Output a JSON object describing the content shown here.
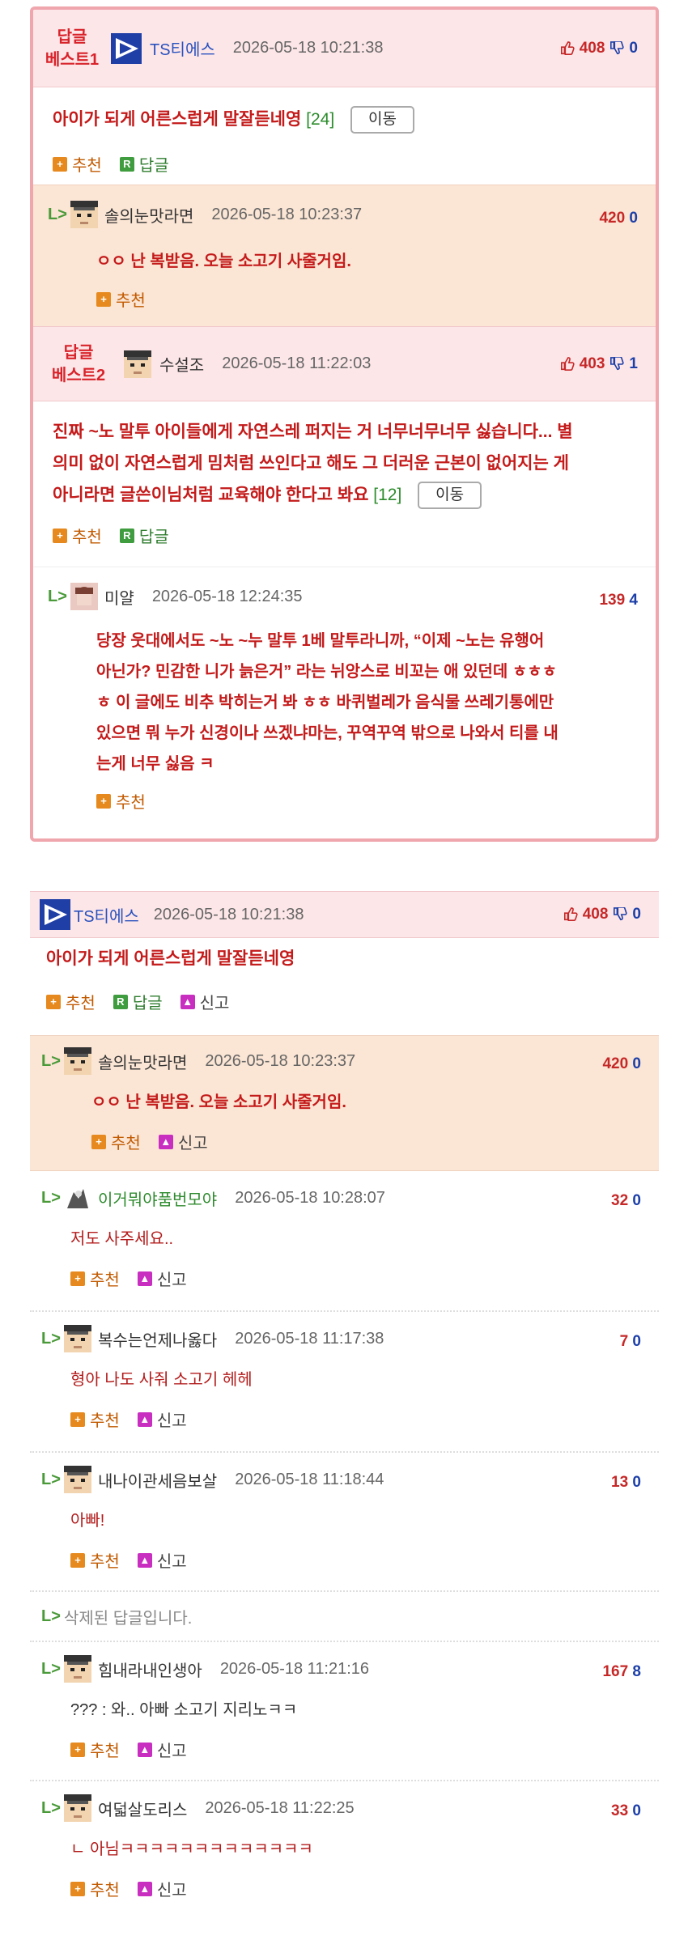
{
  "best_box": {
    "post1": {
      "tag_line1": "답글",
      "tag_line2": "베스트1",
      "author": "TS티에스",
      "date": "2026-05-18 10:21:38",
      "up": "408",
      "down": "0",
      "title": "아이가 되게 어른스럽게 말잘듣네영",
      "count": "[24]",
      "move_label": "이동",
      "recommend_label": "추천",
      "reply_label": "답글"
    },
    "reply1": {
      "author": "솔의눈맛라면",
      "date": "2026-05-18 10:23:37",
      "up": "420",
      "down": "0",
      "text": "ㅇㅇ 난 복받음. 오늘 소고기 사줄거임.",
      "recommend_label": "추천"
    },
    "post2": {
      "tag_line1": "답글",
      "tag_line2": "베스트2",
      "author": "수설조",
      "date": "2026-05-18 11:22:03",
      "up": "403",
      "down": "1",
      "text_line1": "진짜 ~노 말투 아이들에게 자연스레 퍼지는 거 너무너무너무 싫습니다... 별",
      "text_line2": "의미 없이 자연스럽게 밈처럼 쓰인다고 해도 그 더러운 근본이 없어지는 게",
      "text_line3": "아니라면 글쓴이님처럼 교육해야 한다고 봐요",
      "count": "[12]",
      "move_label": "이동",
      "recommend_label": "추천",
      "reply_label": "답글"
    },
    "reply2": {
      "author": "미얄",
      "date": "2026-05-18 12:24:35",
      "up": "139",
      "down": "4",
      "text_line1": "당장 웃대에서도 ~노 ~누 말투 1베 말투라니까, “이제 ~노는 유행어",
      "text_line2": "아닌가? 민감한 니가 늙은거” 라는 뉘앙스로 비꼬는 애 있던데 ㅎㅎㅎ",
      "text_line3": "ㅎ 이 글에도 비추 박히는거 봐 ㅎㅎ 바퀴벌레가 음식물 쓰레기통에만",
      "text_line4": "있으면 뭐 누가 신경이나 쓰겠냐마는, 꾸역꾸역 밖으로 나와서 티를 내",
      "text_line5": "는게 너무 싫음 ㅋ",
      "recommend_label": "추천"
    }
  },
  "thread": {
    "post": {
      "author": "TS티에스",
      "date": "2026-05-18 10:21:38",
      "up": "408",
      "down": "0",
      "title": "아이가 되게 어른스럽게 말잘듣네영",
      "recommend_label": "추천",
      "reply_label": "답글",
      "report_label": "신고"
    },
    "replies": [
      {
        "author": "솔의눈맛라면",
        "date": "2026-05-18 10:23:37",
        "up": "420",
        "down": "0",
        "text": "ㅇㅇ 난 복받음. 오늘 소고기 사줄거임.",
        "recommend_label": "추천",
        "report_label": "신고"
      },
      {
        "author": "이거뭐야품번모야",
        "date": "2026-05-18 10:28:07",
        "up": "32",
        "down": "0",
        "text": "저도 사주세요..",
        "recommend_label": "추천",
        "report_label": "신고"
      },
      {
        "author": "복수는언제나옳다",
        "date": "2026-05-18 11:17:38",
        "up": "7",
        "down": "0",
        "text": "형아 나도 사줘 소고기 헤헤",
        "recommend_label": "추천",
        "report_label": "신고"
      },
      {
        "author": "내나이관세음보살",
        "date": "2026-05-18 11:18:44",
        "up": "13",
        "down": "0",
        "text": "아빠!",
        "recommend_label": "추천",
        "report_label": "신고"
      },
      {
        "deleted_text": "삭제된 답글입니다."
      },
      {
        "author": "힘내라내인생아",
        "date": "2026-05-18 11:21:16",
        "up": "167",
        "down": "8",
        "text": "??? : 와.. 아빠 소고기 지리노ㅋㅋ",
        "recommend_label": "추천",
        "report_label": "신고"
      },
      {
        "author": "여덟살도리스",
        "date": "2026-05-18 11:22:25",
        "up": "33",
        "down": "0",
        "text": "ㄴ 아님ㅋㅋㅋㅋㅋㅋㅋㅋㅋㅋㅋㅋㅋ",
        "recommend_label": "추천",
        "report_label": "신고"
      }
    ]
  },
  "reply_marker": "L>"
}
